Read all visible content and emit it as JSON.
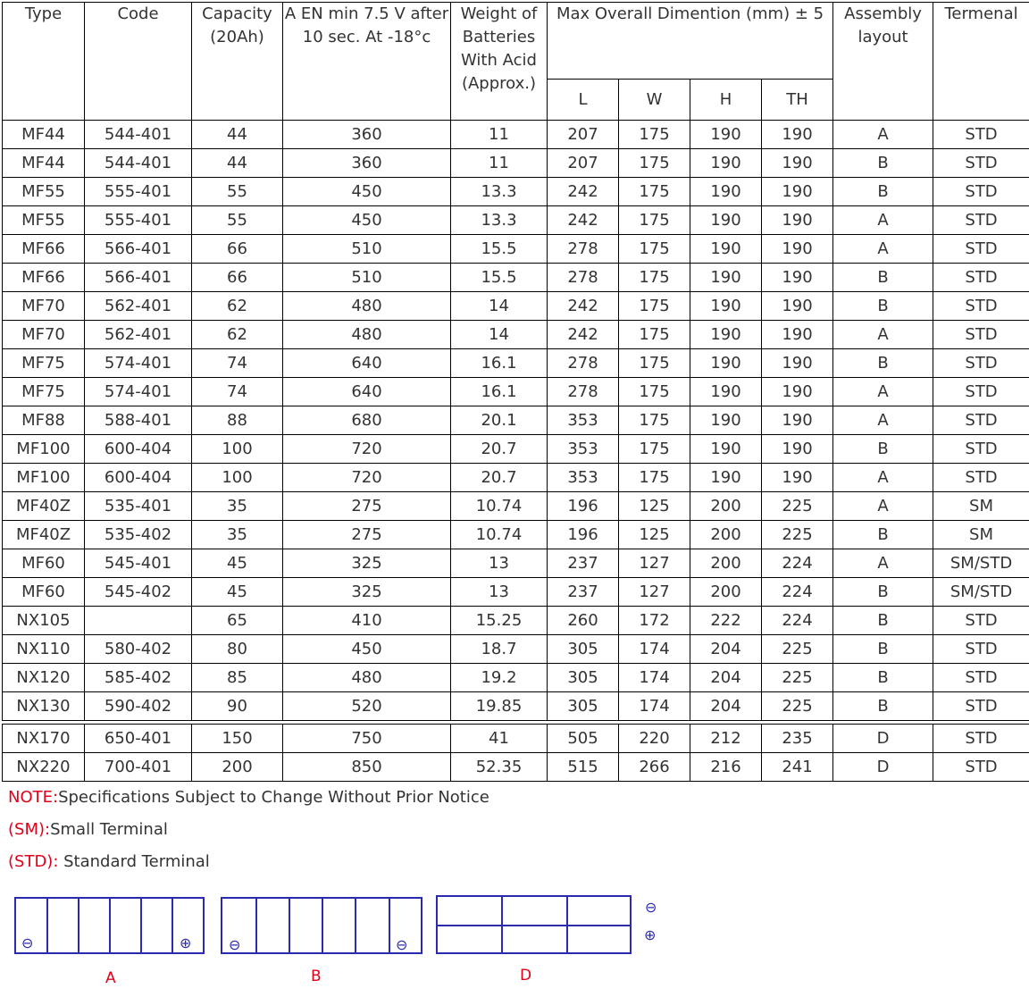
{
  "table": {
    "headers": {
      "type": "Type",
      "code": "Code",
      "capacity": "Capacity (20Ah)",
      "cca": "A EN min 7.5 V after 10 sec. At -18°c",
      "weight": "Weight of Batteries With Acid (Approx.)",
      "dimension": "Max Overall Dimention (mm) ± 5",
      "l": "L",
      "w": "W",
      "h": "H",
      "th": "TH",
      "assembly": "Assembly layout",
      "terminal": "Termenal"
    },
    "rows": [
      [
        "MF44",
        "544-401",
        "44",
        "360",
        "11",
        "207",
        "175",
        "190",
        "190",
        "A",
        "STD"
      ],
      [
        "MF44",
        "544-401",
        "44",
        "360",
        "11",
        "207",
        "175",
        "190",
        "190",
        "B",
        "STD"
      ],
      [
        "MF55",
        "555-401",
        "55",
        "450",
        "13.3",
        "242",
        "175",
        "190",
        "190",
        "B",
        "STD"
      ],
      [
        "MF55",
        "555-401",
        "55",
        "450",
        "13.3",
        "242",
        "175",
        "190",
        "190",
        "A",
        "STD"
      ],
      [
        "MF66",
        "566-401",
        "66",
        "510",
        "15.5",
        "278",
        "175",
        "190",
        "190",
        "A",
        "STD"
      ],
      [
        "MF66",
        "566-401",
        "66",
        "510",
        "15.5",
        "278",
        "175",
        "190",
        "190",
        "B",
        "STD"
      ],
      [
        "MF70",
        "562-401",
        "62",
        "480",
        "14",
        "242",
        "175",
        "190",
        "190",
        "B",
        "STD"
      ],
      [
        "MF70",
        "562-401",
        "62",
        "480",
        "14",
        "242",
        "175",
        "190",
        "190",
        "A",
        "STD"
      ],
      [
        "MF75",
        "574-401",
        "74",
        "640",
        "16.1",
        "278",
        "175",
        "190",
        "190",
        "B",
        "STD"
      ],
      [
        "MF75",
        "574-401",
        "74",
        "640",
        "16.1",
        "278",
        "175",
        "190",
        "190",
        "A",
        "STD"
      ],
      [
        "MF88",
        "588-401",
        "88",
        "680",
        "20.1",
        "353",
        "175",
        "190",
        "190",
        "A",
        "STD"
      ],
      [
        "MF100",
        "600-404",
        "100",
        "720",
        "20.7",
        "353",
        "175",
        "190",
        "190",
        "B",
        "STD"
      ],
      [
        "MF100",
        "600-404",
        "100",
        "720",
        "20.7",
        "353",
        "175",
        "190",
        "190",
        "A",
        "STD"
      ],
      [
        "MF40Z",
        "535-401",
        "35",
        "275",
        "10.74",
        "196",
        "125",
        "200",
        "225",
        "A",
        "SM"
      ],
      [
        "MF40Z",
        "535-402",
        "35",
        "275",
        "10.74",
        "196",
        "125",
        "200",
        "225",
        "B",
        "SM"
      ],
      [
        "MF60",
        "545-401",
        "45",
        "325",
        "13",
        "237",
        "127",
        "200",
        "224",
        "A",
        "SM/STD"
      ],
      [
        "MF60",
        "545-402",
        "45",
        "325",
        "13",
        "237",
        "127",
        "200",
        "224",
        "B",
        "SM/STD"
      ],
      [
        "NX105",
        "",
        "65",
        "410",
        "15.25",
        "260",
        "172",
        "222",
        "224",
        "B",
        "STD"
      ],
      [
        "NX110",
        "580-402",
        "80",
        "450",
        "18.7",
        "305",
        "174",
        "204",
        "225",
        "B",
        "STD"
      ],
      [
        "NX120",
        "585-402",
        "85",
        "480",
        "19.2",
        "305",
        "174",
        "204",
        "225",
        "B",
        "STD"
      ],
      [
        "NX130",
        "590-402",
        "90",
        "520",
        "19.85",
        "305",
        "174",
        "204",
        "225",
        "B",
        "STD"
      ]
    ],
    "rows_bottom": [
      [
        "NX170",
        "650-401",
        "150",
        "750",
        "41",
        "505",
        "220",
        "212",
        "235",
        "D",
        "STD"
      ],
      [
        "NX220",
        "700-401",
        "200",
        "850",
        "52.35",
        "515",
        "266",
        "216",
        "241",
        "D",
        "STD"
      ]
    ]
  },
  "notes": {
    "note_prefix": "NOTE:",
    "note_text": "Specifications Subject to Change Without Prior Notice",
    "sm_prefix": "(SM):",
    "sm_text": "Small Terminal",
    "std_prefix": "(STD):",
    "std_text": " Standard Terminal"
  },
  "layouts": {
    "a_label": "A",
    "b_label": "B",
    "d_label": "D",
    "minus": "⊖",
    "plus": "⊕"
  },
  "colors": {
    "accent_red": "#e0001a",
    "diagram_blue": "#2b2bb0"
  }
}
